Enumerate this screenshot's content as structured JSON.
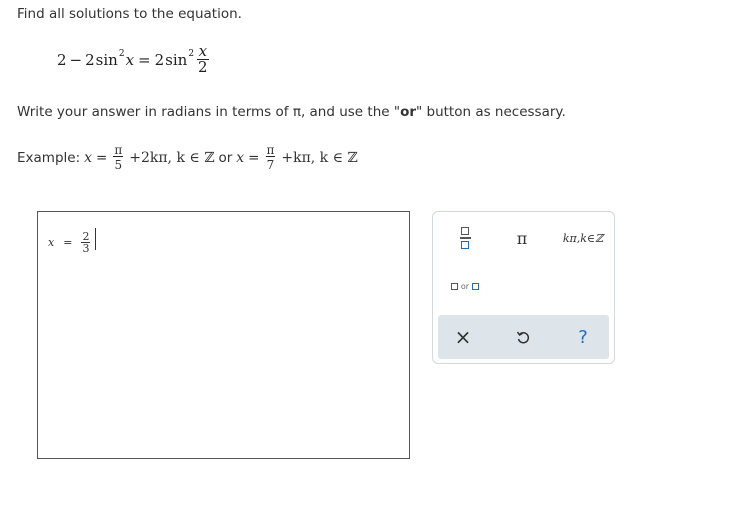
{
  "question": {
    "prompt": "Find all solutions to the equation.",
    "equation": {
      "lhs_const": "2",
      "minus": "−",
      "lhs_coef": "2",
      "fn": "sin",
      "power": "2",
      "var": "x",
      "equals": "=",
      "rhs_coef": "2",
      "frac_num": "x",
      "frac_den": "2"
    },
    "instruction_pre": "Write your answer in radians in terms of π, and use the \"",
    "instruction_bold": "or",
    "instruction_post": "\" button as necessary.",
    "example": {
      "label": "Example:",
      "x1": "x",
      "eq1": "=",
      "frac1_num": "π",
      "frac1_den": "5",
      "term1": "+2kπ, k ∈ ℤ",
      "or": "or",
      "x2": "x",
      "eq2": "=",
      "frac2_num": "π",
      "frac2_den": "7",
      "term2": "+kπ, k ∈ ℤ"
    }
  },
  "answer": {
    "lhs": "x",
    "equals": "=",
    "frac_num": "2",
    "frac_den": "3"
  },
  "palette": {
    "fraction_icon": "fraction-template-icon",
    "pi_label": "π",
    "kpi_label": "kπ,k∈ℤ",
    "or_label": "or",
    "clear_symbol": "×",
    "undo_icon": "undo-icon",
    "help_symbol": "?"
  },
  "colors": {
    "accent_blue": "#1f6fb5",
    "toolbar_bg": "#dde4ea",
    "palette_border": "#d3d9df"
  }
}
